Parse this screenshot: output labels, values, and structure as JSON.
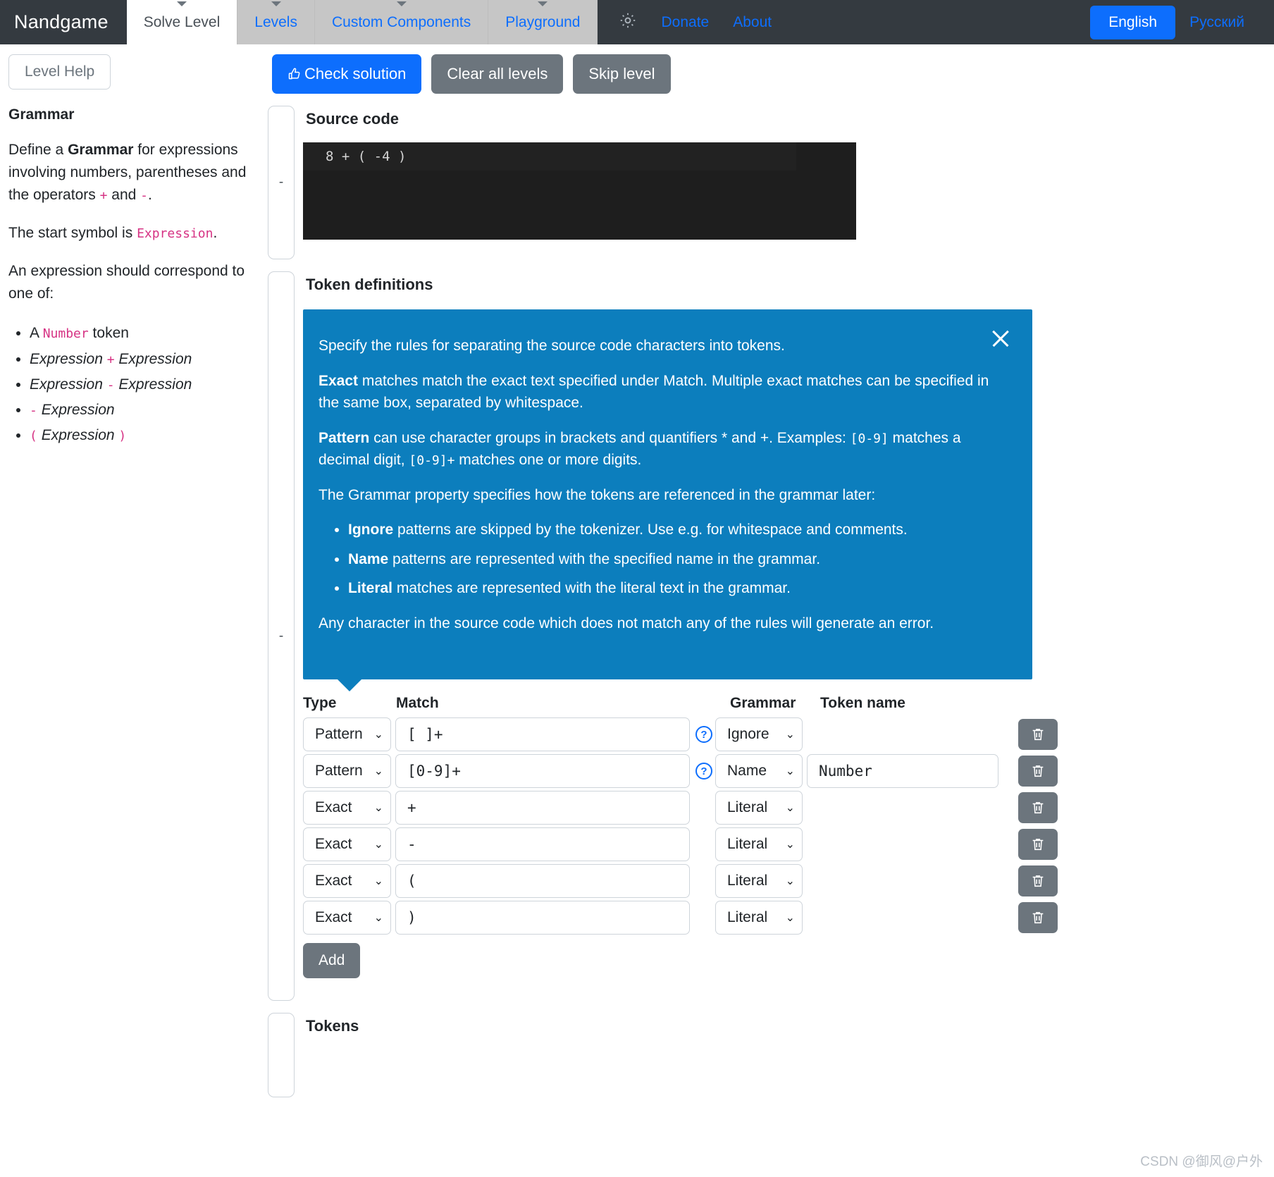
{
  "navbar": {
    "brand": "Nandgame",
    "tabs": [
      {
        "label": "Solve Level",
        "active": true
      },
      {
        "label": "Levels",
        "active": false
      },
      {
        "label": "Custom Components",
        "active": false
      },
      {
        "label": "Playground",
        "active": false
      }
    ],
    "gear_icon": "gear-icon",
    "links": [
      "Donate",
      "About"
    ],
    "language_selected": "English",
    "language_other": "Русский"
  },
  "sidebar": {
    "help_button": "Level Help",
    "heading": "Grammar",
    "p1_a": "Define a ",
    "p1_b": "Grammar",
    "p1_c": " for expressions involving numbers, parentheses and the operators ",
    "p1_plus": "+",
    "p1_d": " and ",
    "p1_minus": "-",
    "p1_e": ".",
    "p2_a": "The start symbol is ",
    "p2_sym": "Expression",
    "p2_b": ".",
    "p3": "An expression should correspond to one of:",
    "rules": [
      {
        "pre": "A ",
        "code": "Number",
        "post": " token"
      },
      {
        "a": "Expression",
        "op": "+",
        "b": "Expression"
      },
      {
        "a": "Expression",
        "op": "-",
        "b": "Expression"
      },
      {
        "op": "-",
        "b": "Expression"
      },
      {
        "open": "(",
        "b": "Expression",
        "close": ")"
      }
    ]
  },
  "toolbar": {
    "check_solution": "Check solution",
    "clear_all_levels": "Clear all levels",
    "skip_level": "Skip level",
    "thumb_icon": "thumbs-up-icon"
  },
  "source_section": {
    "title": "Source code",
    "code": "8 + ( -4 )",
    "collapse_label": "-"
  },
  "token_section": {
    "title": "Token definitions",
    "collapse_label": "-"
  },
  "tip": {
    "close_icon": "close-icon",
    "line1": "Specify the rules for separating the source code characters into tokens.",
    "line2_bold": "Exact",
    "line2_rest": " matches match the exact text specified under Match. Multiple exact matches can be specified in the same box, separated by whitespace.",
    "line3_bold": "Pattern",
    "line3_a": " can use character groups in brackets and quantifiers * and +. Examples: ",
    "line3_code1": "[0-9]",
    "line3_b": " matches a decimal digit, ",
    "line3_code2": "[0-9]+",
    "line3_c": " matches one or more digits.",
    "line4": "The Grammar property specifies how the tokens are referenced in the grammar later:",
    "bullets": [
      {
        "bold": "Ignore",
        "rest": " patterns are skipped by the tokenizer. Use e.g. for whitespace and comments."
      },
      {
        "bold": "Name",
        "rest": " patterns are represented with the specified name in the grammar."
      },
      {
        "bold": "Literal",
        "rest": " matches are represented with the literal text in the grammar."
      }
    ],
    "line5": "Any character in the source code which does not match any of the rules will generate an error."
  },
  "table": {
    "headers": {
      "type": "Type",
      "match": "Match",
      "grammar": "Grammar",
      "token_name": "Token name"
    },
    "rows": [
      {
        "type": "Pattern",
        "match": "[ ]+",
        "help": true,
        "grammar": "Ignore",
        "token_name": "",
        "has_name_box": false,
        "delete_icon": "trash-icon"
      },
      {
        "type": "Pattern",
        "match": "[0-9]+",
        "help": true,
        "grammar": "Name",
        "token_name": "Number",
        "has_name_box": true,
        "delete_icon": "trash-icon"
      },
      {
        "type": "Exact",
        "match": "+",
        "help": false,
        "grammar": "Literal",
        "token_name": "",
        "has_name_box": false,
        "delete_icon": "trash-icon"
      },
      {
        "type": "Exact",
        "match": "-",
        "help": false,
        "grammar": "Literal",
        "token_name": "",
        "has_name_box": false,
        "delete_icon": "trash-icon"
      },
      {
        "type": "Exact",
        "match": "(",
        "help": false,
        "grammar": "Literal",
        "token_name": "",
        "has_name_box": false,
        "delete_icon": "trash-icon"
      },
      {
        "type": "Exact",
        "match": ")",
        "help": false,
        "grammar": "Literal",
        "token_name": "",
        "has_name_box": false,
        "delete_icon": "trash-icon"
      }
    ],
    "add_button": "Add"
  },
  "tokens_section": {
    "title": "Tokens",
    "collapse_label": ""
  },
  "watermark": "CSDN @御风@户外",
  "colors": {
    "navbar_bg": "#343a40",
    "accent_blue": "#0d6efd",
    "tip_blue": "#0c7ebd",
    "gray_btn": "#6c757d",
    "code_pink": "#d63384"
  }
}
